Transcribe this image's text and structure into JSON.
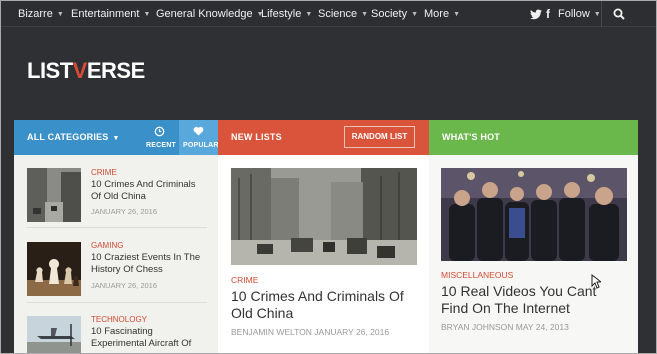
{
  "nav": {
    "items": [
      {
        "label": "Bizarre"
      },
      {
        "label": "Entertainment"
      },
      {
        "label": "General Knowledge"
      },
      {
        "label": "Lifestyle"
      },
      {
        "label": "Science"
      },
      {
        "label": "Society"
      },
      {
        "label": "More"
      }
    ],
    "follow_label": "Follow",
    "icons": [
      "twitter-icon",
      "facebook-icon",
      "search-icon"
    ]
  },
  "logo": {
    "part1": "LIST",
    "accent": "V",
    "part2": "ERSE"
  },
  "tabs": {
    "all_categories": "ALL CATEGORIES",
    "recent": "RECENT",
    "popular": "POPULAR",
    "new_lists": "NEW LISTS",
    "random_list": "RANDOM LIST",
    "whats_hot": "WHAT'S HOT"
  },
  "sidebar_list": [
    {
      "category": "CRIME",
      "title_line1": "10 Crimes And Criminals",
      "title_line2": "Of Old China",
      "date": "JANUARY 26, 2016"
    },
    {
      "category": "GAMING",
      "title_line1": "10 Craziest Events In The",
      "title_line2": "History Of Chess",
      "date": "JANUARY 26, 2016"
    },
    {
      "category": "TECHNOLOGY",
      "title_line1": "10 Fascinating",
      "title_line2": "Experimental Aircraft Of",
      "date": ""
    }
  ],
  "new_list": {
    "category": "CRIME",
    "title_line1": "10 Crimes And Criminals Of",
    "title_line2": "Old China",
    "meta": "BENJAMIN WELTON JANUARY 26, 2016"
  },
  "hot_list": {
    "category": "MISCELLANEOUS",
    "title_line1": "10 Real Videos You Cant",
    "title_line2": "Find On The Internet",
    "meta": "BRYAN JOHNSON MAY 24, 2013"
  },
  "colors": {
    "nav_bg": "#2c2e31",
    "blue": "#3a90c9",
    "red": "#d9543a",
    "green": "#6ab74c",
    "category_red": "#d04a33"
  }
}
